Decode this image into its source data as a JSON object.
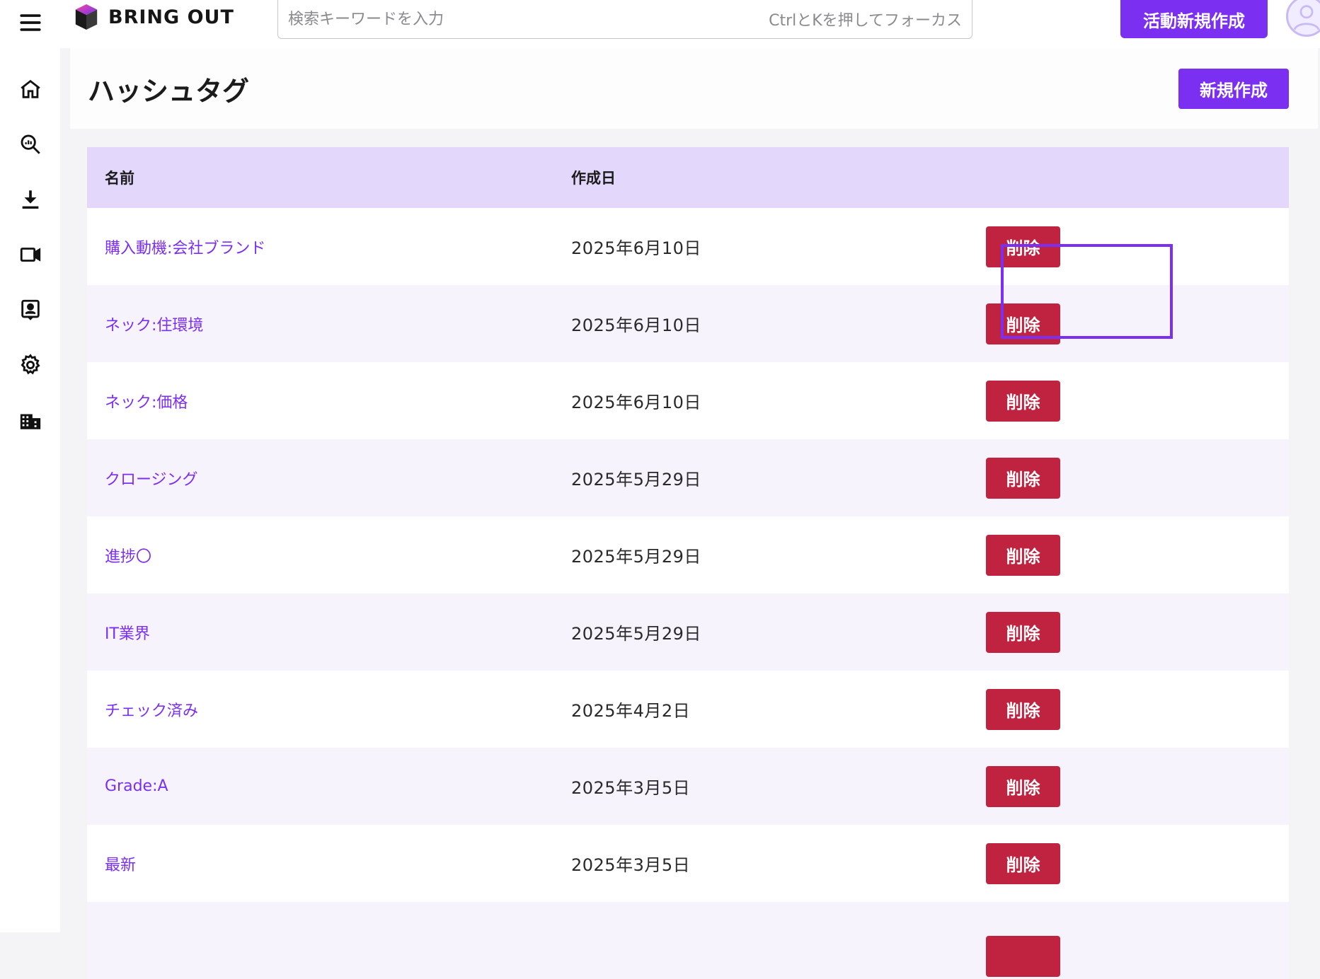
{
  "header": {
    "logo_text": "BRING OUT",
    "search_placeholder": "検索キーワードを入力",
    "search_hint": "CtrlとKを押してフォーカス",
    "new_activity_label": "活動新規作成"
  },
  "sidebar": {
    "items": [
      {
        "icon": "home-icon"
      },
      {
        "icon": "search-analytics-icon"
      },
      {
        "icon": "download-icon"
      },
      {
        "icon": "video-icon"
      },
      {
        "icon": "contact-card-icon"
      },
      {
        "icon": "gear-icon"
      },
      {
        "icon": "building-icon"
      }
    ]
  },
  "page": {
    "title": "ハッシュタグ",
    "new_button_label": "新規作成"
  },
  "table": {
    "columns": {
      "name": "名前",
      "created": "作成日"
    },
    "delete_label": "削除",
    "rows": [
      {
        "name": "購入動機:会社ブランド",
        "created": "2025年6月10日"
      },
      {
        "name": "ネック:住環境",
        "created": "2025年6月10日"
      },
      {
        "name": "ネック:価格",
        "created": "2025年6月10日"
      },
      {
        "name": "クロージング",
        "created": "2025年5月29日"
      },
      {
        "name": "進捗〇",
        "created": "2025年5月29日"
      },
      {
        "name": "IT業界",
        "created": "2025年5月29日"
      },
      {
        "name": "チェック済み",
        "created": "2025年4月2日"
      },
      {
        "name": "Grade:A",
        "created": "2025年3月5日"
      },
      {
        "name": "最新",
        "created": "2025年3月5日"
      },
      {
        "name": "",
        "created": ""
      }
    ]
  },
  "colors": {
    "accent": "#7b2ff0",
    "danger": "#c0233f",
    "table_header": "#e3d8fb"
  }
}
